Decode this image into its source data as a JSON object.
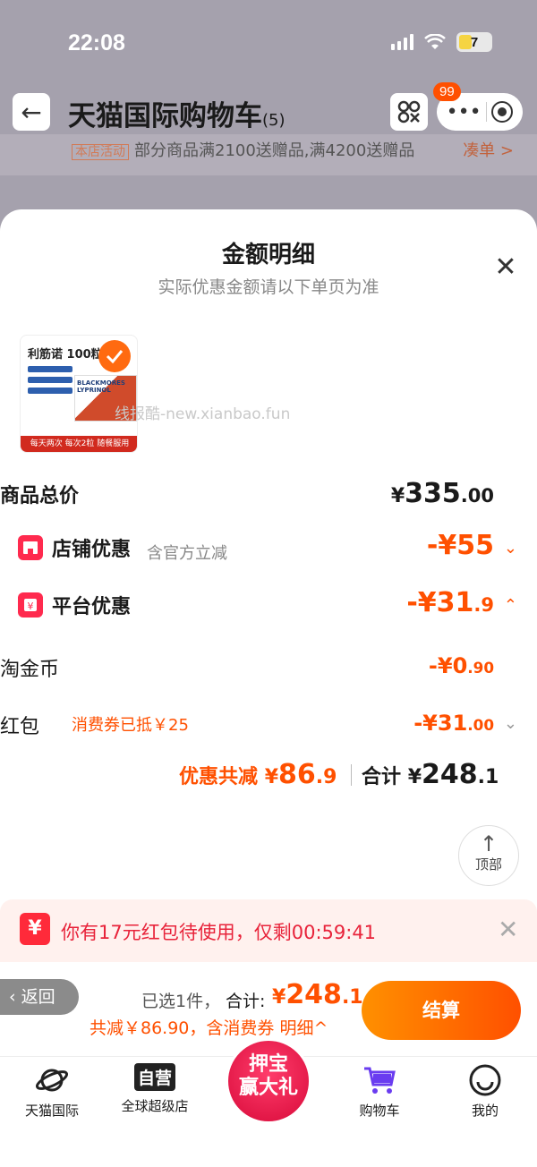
{
  "status_bar": {
    "time": "22:08",
    "battery": "7"
  },
  "nav": {
    "title": "天猫国际购物车",
    "count": "(5)",
    "badge": "99"
  },
  "background": {
    "promo_tag": "本店活动",
    "promo_text": "部分商品满2100送赠品,满4200送赠品",
    "promo_link": "凑单 >"
  },
  "sheet": {
    "title": "金额明细",
    "subtitle": "实际优惠金额请以下单页为准"
  },
  "product": {
    "name": "利筋诺 100粒",
    "brand": "BLACKMORES LYPRINOL",
    "banner": "每天两次 每次2粒 随餐服用"
  },
  "watermark": "线报酷-new.xianbao.fun",
  "rows": {
    "goods_total": {
      "label": "商品总价",
      "currency": "¥",
      "int": "335",
      "dec": ".00"
    },
    "shop_discount": {
      "label": "店铺优惠",
      "note": "含官方立减",
      "value": "-¥55"
    },
    "platform_discount": {
      "label": "平台优惠",
      "int": "-¥31",
      "dec": ".9"
    },
    "taojinbi": {
      "label": "淘金币",
      "int": "-¥0",
      "dec": ".90"
    },
    "hongbao": {
      "label": "红包",
      "note": "消费券已抵￥25",
      "int": "-¥31",
      "dec": ".00"
    }
  },
  "summary": {
    "saving_label": "优惠共减",
    "saving_currency": "¥",
    "saving_int": "86",
    "saving_dec": ".9",
    "total_label": "合计",
    "total_currency": "¥",
    "total_int": "248",
    "total_dec": ".1"
  },
  "top_button": "顶部",
  "coupon_banner": {
    "icon": "¥",
    "text": "你有17元红包待使用，仅剩00:59:41"
  },
  "checkout": {
    "return": "返回",
    "selected": "已选1件，",
    "total_label": "合计:",
    "total_currency": "¥",
    "total_int": "248",
    "total_dec": ".1",
    "discount_text": "共减￥86.90，含消费券",
    "detail_link": "明细^",
    "button": "结算"
  },
  "tabs": [
    {
      "label": "天猫国际",
      "icon": "planet-icon"
    },
    {
      "label": "全球超级店",
      "icon": "ziying-icon",
      "icon_text": "自营"
    },
    {
      "label": "购物车",
      "icon": "cart-icon"
    },
    {
      "label": "我的",
      "icon": "smile-icon"
    }
  ],
  "promo_bubble": {
    "line1": "押宝",
    "line2": "赢大礼"
  },
  "colors": {
    "accent": "#ff5000",
    "red": "#ff2a4e",
    "purple": "#6a3cf0"
  }
}
